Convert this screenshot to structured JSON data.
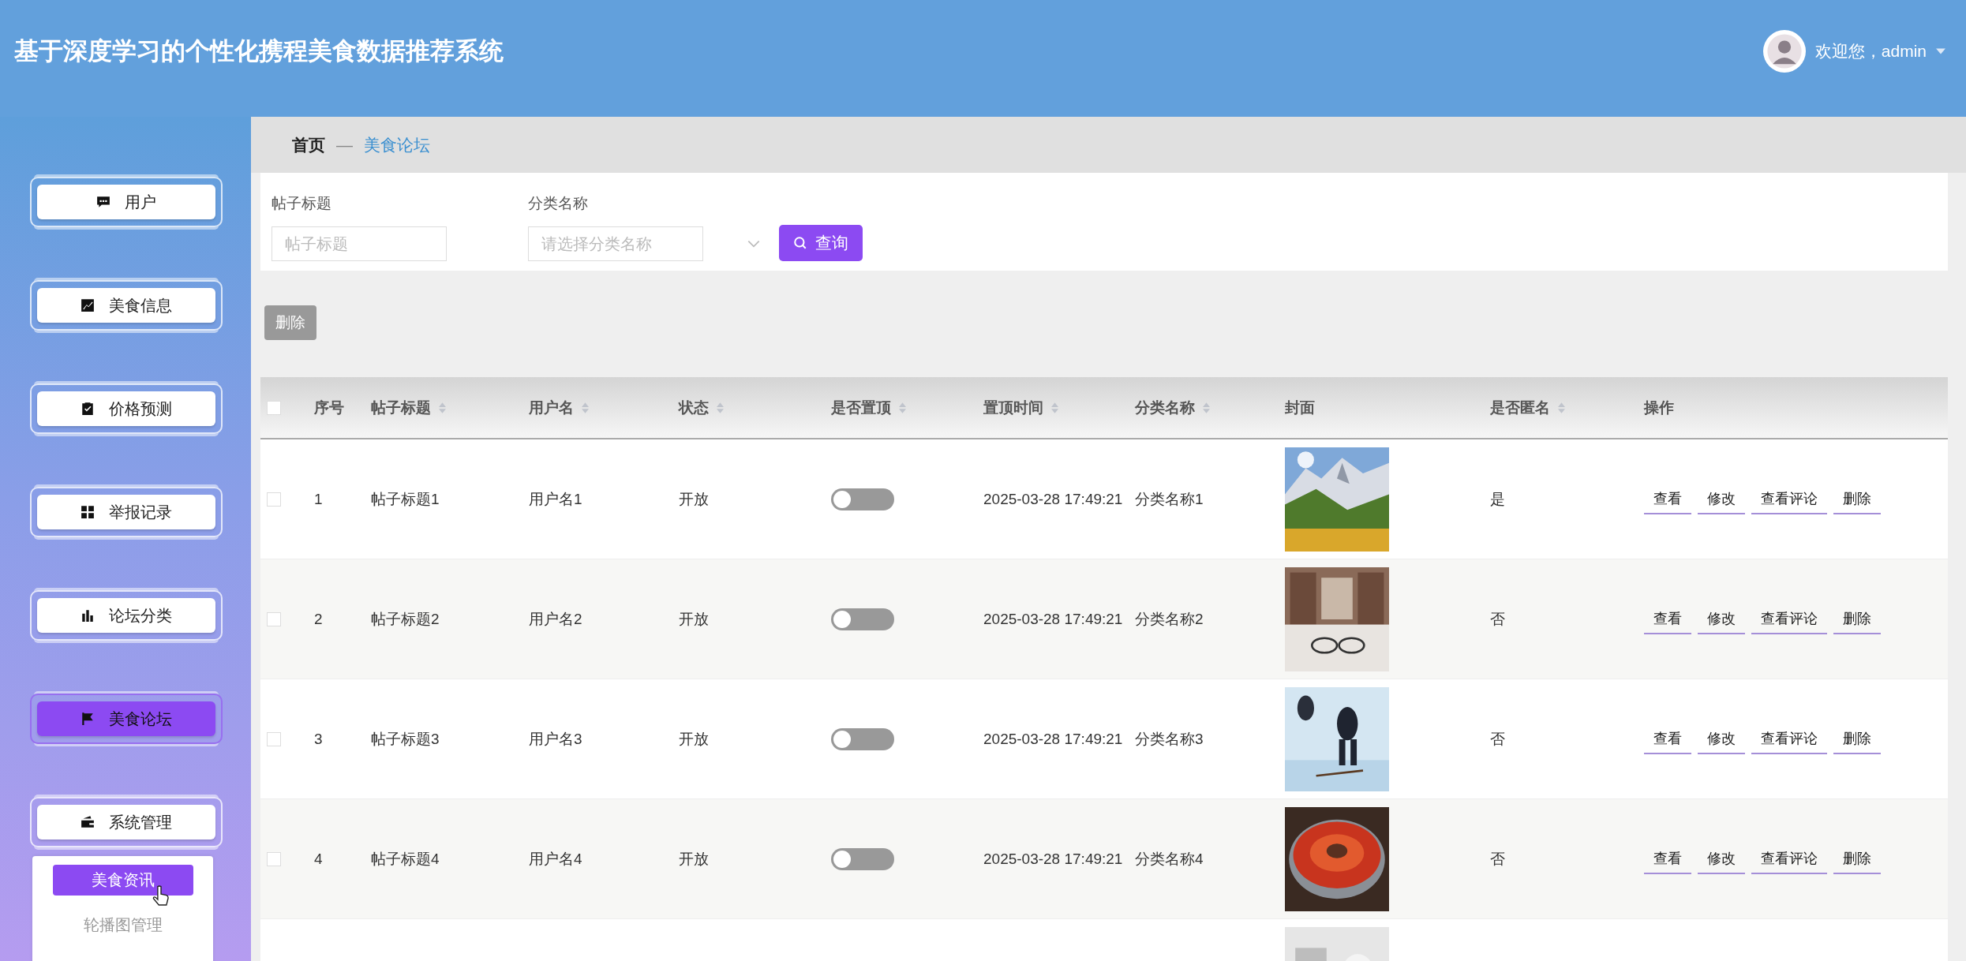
{
  "header": {
    "title": "基于深度学习的个性化携程美食数据推荐系统",
    "welcome": "欢迎您，admin"
  },
  "sidebar": {
    "items": [
      {
        "label": "用户",
        "selected": false
      },
      {
        "label": "美食信息",
        "selected": false
      },
      {
        "label": "价格预测",
        "selected": false
      },
      {
        "label": "举报记录",
        "selected": false
      },
      {
        "label": "论坛分类",
        "selected": false
      },
      {
        "label": "美食论坛",
        "selected": true
      },
      {
        "label": "系统管理",
        "selected": false
      }
    ],
    "submenu": [
      {
        "label": "美食资讯",
        "selected": true
      },
      {
        "label": "轮播图管理",
        "selected": false
      }
    ]
  },
  "breadcrumb": {
    "home": "首页",
    "separator": "—",
    "current": "美食论坛"
  },
  "search": {
    "fields": [
      {
        "kind": "input",
        "label": "帖子标题",
        "placeholder": "帖子标题"
      },
      {
        "kind": "select",
        "label": "分类名称",
        "placeholder": "请选择分类名称"
      }
    ],
    "button": "查询"
  },
  "toolbar": {
    "delete": "删除"
  },
  "table": {
    "header_checked": false,
    "columns": [
      {
        "label": "序号",
        "sortable": false
      },
      {
        "label": "帖子标题",
        "sortable": true
      },
      {
        "label": "用户名",
        "sortable": true
      },
      {
        "label": "状态",
        "sortable": true
      },
      {
        "label": "是否置顶",
        "sortable": true
      },
      {
        "label": "置顶时间",
        "sortable": true
      },
      {
        "label": "分类名称",
        "sortable": true
      },
      {
        "label": "封面",
        "sortable": false
      },
      {
        "label": "是否匿名",
        "sortable": true
      },
      {
        "label": "操作",
        "sortable": false
      }
    ],
    "rows": [
      {
        "checked": false,
        "index": "1",
        "title": "帖子标题1",
        "user": "用户名1",
        "status": "开放",
        "pinned": false,
        "pin_time": "2025-03-28 17:49:21",
        "category": "分类名称1",
        "cover": {
          "kind": "picture"
        },
        "anonymous": "是",
        "actions": [
          "查看",
          "修改",
          "查看评论",
          "删除"
        ]
      },
      {
        "checked": false,
        "index": "2",
        "title": "帖子标题2",
        "user": "用户名2",
        "status": "开放",
        "pinned": false,
        "pin_time": "2025-03-28 17:49:21",
        "category": "分类名称2",
        "cover": {
          "kind": "picture"
        },
        "anonymous": "否",
        "actions": [
          "查看",
          "修改",
          "查看评论",
          "删除"
        ]
      },
      {
        "checked": false,
        "index": "3",
        "title": "帖子标题3",
        "user": "用户名3",
        "status": "开放",
        "pinned": false,
        "pin_time": "2025-03-28 17:49:21",
        "category": "分类名称3",
        "cover": {
          "kind": "picture"
        },
        "anonymous": "否",
        "actions": [
          "查看",
          "修改",
          "查看评论",
          "删除"
        ]
      },
      {
        "checked": false,
        "index": "4",
        "title": "帖子标题4",
        "user": "用户名4",
        "status": "开放",
        "pinned": false,
        "pin_time": "2025-03-28 17:49:21",
        "category": "分类名称4",
        "cover": {
          "kind": "picture"
        },
        "anonymous": "否",
        "actions": [
          "查看",
          "修改",
          "查看评论",
          "删除"
        ]
      },
      {
        "cover": {
          "kind": "picture"
        }
      }
    ]
  }
}
